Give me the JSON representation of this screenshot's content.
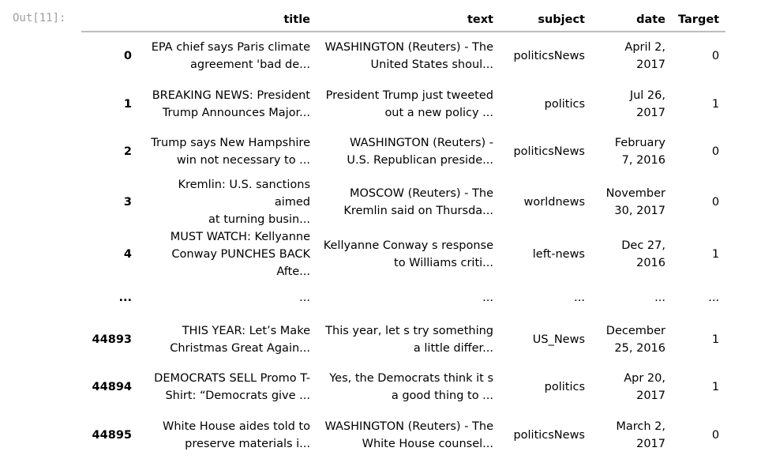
{
  "cell": {
    "prompt": "Out[11]:"
  },
  "table": {
    "columns": [
      "title",
      "text",
      "subject",
      "date",
      "Target"
    ],
    "rows": [
      {
        "index": "0",
        "title": [
          "EPA chief says Paris climate",
          "agreement 'bad de..."
        ],
        "text": [
          "WASHINGTON (Reuters) - The",
          "United States shoul..."
        ],
        "subject": "politicsNews",
        "date": [
          "April 2,",
          "2017"
        ],
        "target": "0"
      },
      {
        "index": "1",
        "title": [
          "BREAKING NEWS: President",
          "Trump Announces Major..."
        ],
        "text": [
          "President Trump just tweeted",
          "out a new policy ..."
        ],
        "subject": "politics",
        "date": [
          "Jul 26,",
          "2017"
        ],
        "target": "1"
      },
      {
        "index": "2",
        "title": [
          "Trump says New Hampshire",
          "win not necessary to ..."
        ],
        "text": [
          "WASHINGTON (Reuters) -",
          "U.S. Republican preside..."
        ],
        "subject": "politicsNews",
        "date": [
          "February",
          "7, 2016"
        ],
        "target": "0"
      },
      {
        "index": "3",
        "title": [
          "Kremlin: U.S. sanctions aimed",
          "at turning busin..."
        ],
        "text": [
          "MOSCOW (Reuters) - The",
          "Kremlin said on Thursda..."
        ],
        "subject": "worldnews",
        "date": [
          "November",
          "30, 2017"
        ],
        "target": "0"
      },
      {
        "index": "4",
        "title": [
          "MUST WATCH: Kellyanne",
          "Conway PUNCHES BACK Afte..."
        ],
        "text": [
          "Kellyanne Conway s response",
          "to Williams criti..."
        ],
        "subject": "left-news",
        "date": [
          "Dec 27,",
          "2016"
        ],
        "target": "1"
      }
    ],
    "ellipsis": "...",
    "tail_rows": [
      {
        "index": "44893",
        "title": [
          "THIS YEAR: Let’s Make",
          "Christmas Great Again..."
        ],
        "text": [
          "This year, let s try something",
          "a little differ..."
        ],
        "subject": "US_News",
        "date": [
          "December",
          "25, 2016"
        ],
        "target": "1"
      },
      {
        "index": "44894",
        "title": [
          "DEMOCRATS SELL Promo T-",
          "Shirt: “Democrats give ..."
        ],
        "text": [
          "Yes, the Democrats think it s",
          "a good thing to ..."
        ],
        "subject": "politics",
        "date": [
          "Apr 20,",
          "2017"
        ],
        "target": "1"
      },
      {
        "index": "44895",
        "title": [
          "White House aides told to",
          "preserve materials i..."
        ],
        "text": [
          "WASHINGTON (Reuters) - The",
          "White House counsel..."
        ],
        "subject": "politicsNews",
        "date": [
          "March 2,",
          "2017"
        ],
        "target": "0"
      }
    ]
  }
}
